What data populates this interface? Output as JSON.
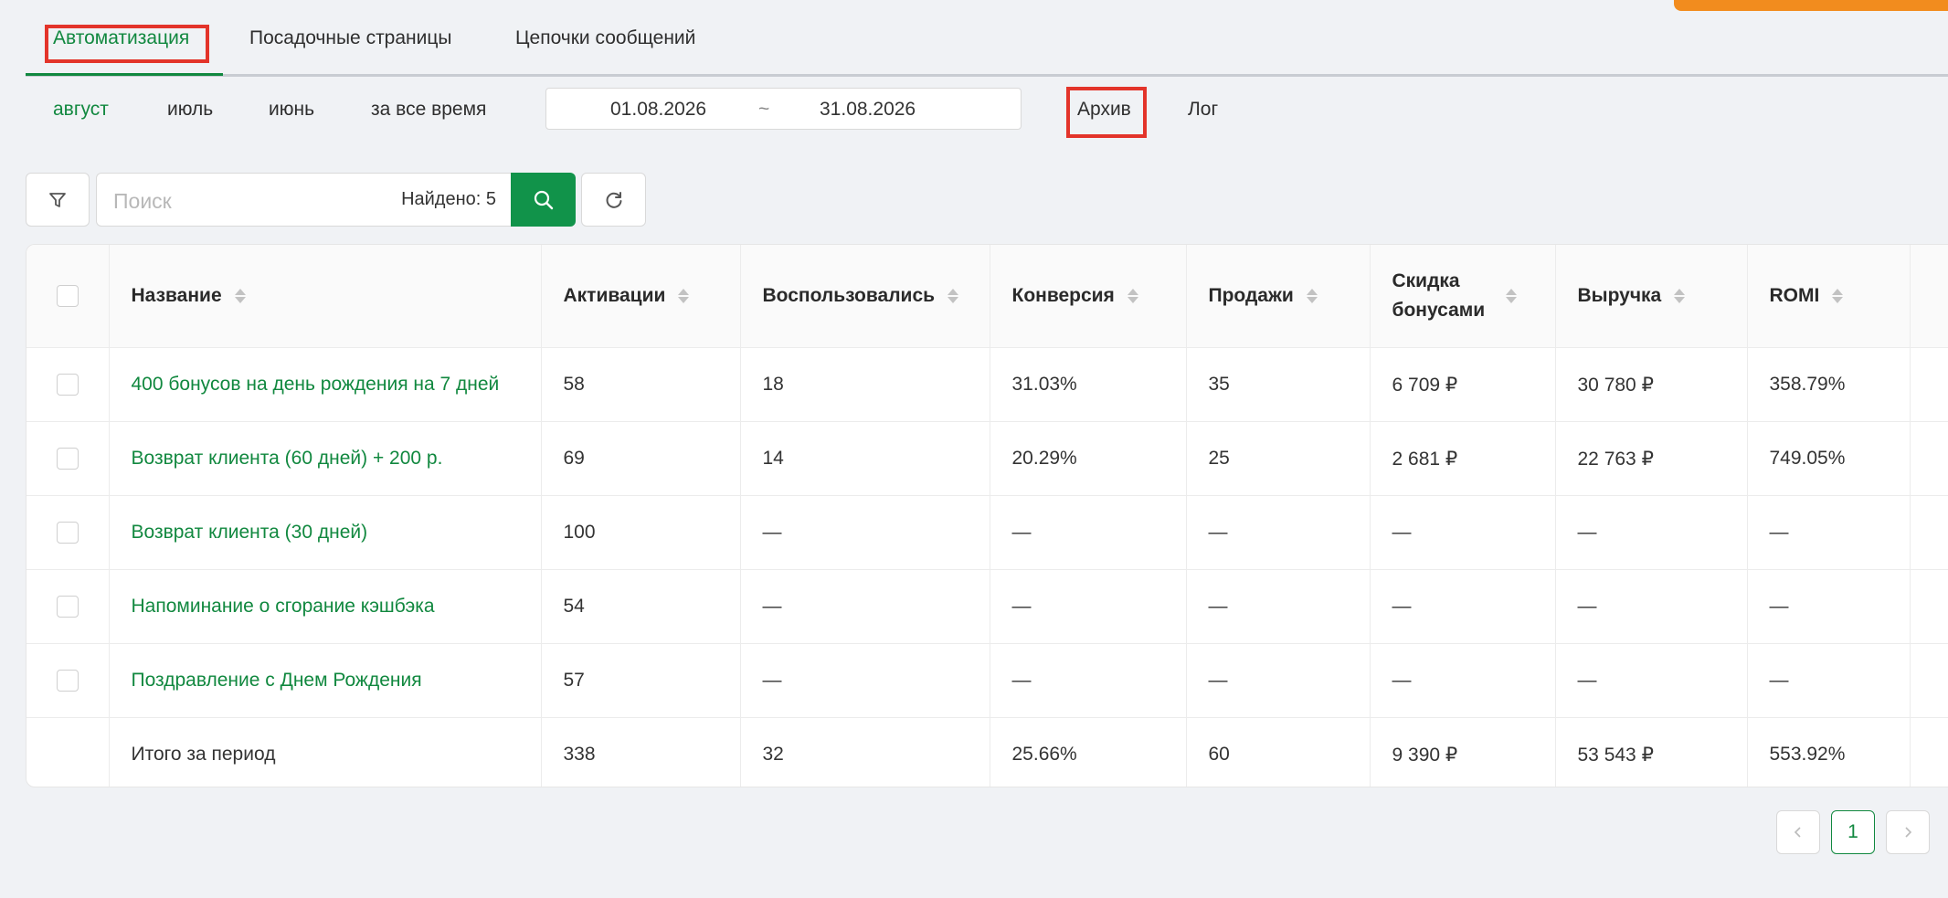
{
  "tabs": [
    {
      "label": "Автоматизация",
      "active": true
    },
    {
      "label": "Посадочные страницы",
      "active": false
    },
    {
      "label": "Цепочки сообщений",
      "active": false
    }
  ],
  "periods": [
    {
      "label": "август",
      "active": true
    },
    {
      "label": "июль",
      "active": false
    },
    {
      "label": "июнь",
      "active": false
    },
    {
      "label": "за все время",
      "active": false
    }
  ],
  "date_range": {
    "from": "01.08.2026",
    "separator": "~",
    "to": "31.08.2026"
  },
  "links": {
    "archive": "Архив",
    "log": "Лог"
  },
  "search": {
    "placeholder": "Поиск",
    "found_text": "Найдено: 5"
  },
  "table": {
    "headers": [
      "Название",
      "Активации",
      "Воспользовались",
      "Конверсия",
      "Продажи",
      "Скидка бонусами",
      "Выручка",
      "ROMI"
    ],
    "rows": [
      [
        "400 бонусов на день рождения на 7 дней",
        "58",
        "18",
        "31.03%",
        "35",
        "6 709 ₽",
        "30 780 ₽",
        "358.79%"
      ],
      [
        "Возврат клиента (60 дней) + 200 р.",
        "69",
        "14",
        "20.29%",
        "25",
        "2 681 ₽",
        "22 763 ₽",
        "749.05%"
      ],
      [
        "Возврат клиента (30 дней)",
        "100",
        "—",
        "—",
        "—",
        "—",
        "—",
        "—"
      ],
      [
        "Напоминание о сгорание кэшбэка",
        "54",
        "—",
        "—",
        "—",
        "—",
        "—",
        "—"
      ],
      [
        "Поздравление с Днем Рождения",
        "57",
        "—",
        "—",
        "—",
        "—",
        "—",
        "—"
      ]
    ],
    "total": [
      "Итого за период",
      "338",
      "32",
      "25.66%",
      "60",
      "9 390 ₽",
      "53 543 ₽",
      "553.92%"
    ]
  },
  "pagination": {
    "current": "1",
    "prev_icon": "chevron-left-icon",
    "next_icon": "chevron-right-icon"
  },
  "colors": {
    "accent": "#11883f",
    "highlight": "#e3342a",
    "top_bar": "#f28c1e"
  }
}
